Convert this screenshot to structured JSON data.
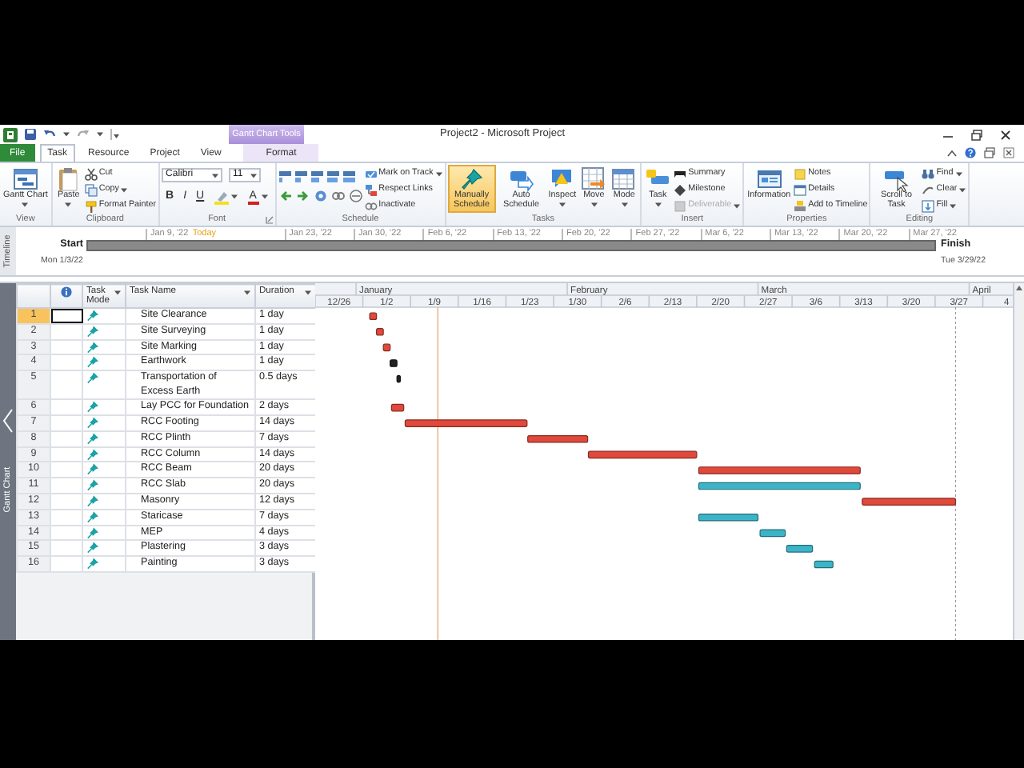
{
  "title_bar": {
    "context_group": "Gantt Chart Tools",
    "title": "Project2 - Microsoft Project"
  },
  "tabs": [
    {
      "label": "File",
      "kind": "file",
      "selected": false
    },
    {
      "label": "Task",
      "kind": "normal",
      "selected": true
    },
    {
      "label": "Resource",
      "kind": "normal",
      "selected": false
    },
    {
      "label": "Project",
      "kind": "normal",
      "selected": false
    },
    {
      "label": "View",
      "kind": "normal",
      "selected": false
    },
    {
      "label": "Format",
      "kind": "context",
      "selected": false
    }
  ],
  "ribbon": {
    "groups": [
      {
        "label": "View",
        "launcher": false,
        "items": [
          {
            "kind": "large",
            "label": "Gantt Chart",
            "caret": true,
            "selected": false
          }
        ]
      },
      {
        "label": "Clipboard",
        "launcher": false,
        "items": [
          {
            "kind": "large",
            "label": "Paste",
            "caret": true,
            "selected": false
          },
          {
            "kind": "stack",
            "entries": [
              {
                "label": "Cut",
                "caret": false,
                "disabled": false
              },
              {
                "label": "Copy",
                "caret": true,
                "disabled": false
              },
              {
                "label": "Format Painter",
                "caret": false,
                "disabled": false
              }
            ]
          }
        ]
      },
      {
        "label": "Font",
        "launcher": true,
        "items": [
          {
            "kind": "font",
            "font": "Calibri",
            "size": "11",
            "styles": [
              "B",
              "I",
              "U"
            ],
            "color_glyph": "A"
          }
        ]
      },
      {
        "label": "Schedule",
        "launcher": false,
        "items": [
          {
            "kind": "icon-grid"
          },
          {
            "kind": "stack",
            "entries": [
              {
                "label": "Mark on Track",
                "caret": true,
                "disabled": false
              },
              {
                "label": "Respect Links",
                "caret": false,
                "disabled": false
              },
              {
                "label": "Inactivate",
                "caret": false,
                "disabled": false
              }
            ]
          }
        ]
      },
      {
        "label": "Tasks",
        "launcher": false,
        "items": [
          {
            "kind": "large",
            "label": "Manually Schedule",
            "caret": false,
            "selected": true
          },
          {
            "kind": "large",
            "label": "Auto Schedule",
            "caret": false,
            "selected": false
          },
          {
            "kind": "large",
            "label": "Inspect",
            "caret": true,
            "selected": false
          },
          {
            "kind": "large",
            "label": "Move",
            "caret": true,
            "selected": false
          },
          {
            "kind": "large",
            "label": "Mode",
            "caret": true,
            "selected": false
          }
        ]
      },
      {
        "label": "Insert",
        "launcher": false,
        "items": [
          {
            "kind": "large",
            "label": "Task",
            "caret": true,
            "selected": false
          },
          {
            "kind": "stack",
            "entries": [
              {
                "label": "Summary",
                "caret": false,
                "disabled": false
              },
              {
                "label": "Milestone",
                "caret": false,
                "disabled": false
              },
              {
                "label": "Deliverable",
                "caret": true,
                "disabled": true
              }
            ]
          }
        ]
      },
      {
        "label": "Properties",
        "launcher": false,
        "items": [
          {
            "kind": "large",
            "label": "Information",
            "caret": false,
            "selected": false
          },
          {
            "kind": "stack",
            "entries": [
              {
                "label": "Notes",
                "caret": false,
                "disabled": false
              },
              {
                "label": "Details",
                "caret": false,
                "disabled": false
              },
              {
                "label": "Add to Timeline",
                "caret": false,
                "disabled": false
              }
            ]
          }
        ]
      },
      {
        "label": "Editing",
        "launcher": false,
        "items": [
          {
            "kind": "large",
            "label": "Scroll to Task",
            "caret": false,
            "selected": false
          },
          {
            "kind": "stack",
            "entries": [
              {
                "label": "Find",
                "caret": true,
                "disabled": false
              },
              {
                "label": "Clear",
                "caret": true,
                "disabled": false
              },
              {
                "label": "Fill",
                "caret": true,
                "disabled": false
              }
            ]
          }
        ]
      }
    ]
  },
  "timeline": {
    "label": "Timeline",
    "start_label": "Start",
    "start_date": "Mon 1/3/22",
    "finish_label": "Finish",
    "finish_date": "Tue 3/29/22",
    "ticks": [
      {
        "label": "Jan 9, '22",
        "kind": "date"
      },
      {
        "label": "Today",
        "kind": "today"
      },
      {
        "label": "Jan 23, '22",
        "kind": "date"
      },
      {
        "label": "Jan 30, '22",
        "kind": "date"
      },
      {
        "label": "Feb 6, '22",
        "kind": "date"
      },
      {
        "label": "Feb 13, '22",
        "kind": "date"
      },
      {
        "label": "Feb 20, '22",
        "kind": "date"
      },
      {
        "label": "Feb 27, '22",
        "kind": "date"
      },
      {
        "label": "Mar 6, '22",
        "kind": "date"
      },
      {
        "label": "Mar 13, '22",
        "kind": "date"
      },
      {
        "label": "Mar 20, '22",
        "kind": "date"
      },
      {
        "label": "Mar 27, '22",
        "kind": "date"
      }
    ]
  },
  "view_bar": {
    "label": "Gantt Chart"
  },
  "table": {
    "columns": [
      {
        "kind": "indicators"
      },
      {
        "kind": "mode",
        "label": "Task Mode"
      },
      {
        "kind": "name",
        "label": "Task Name"
      },
      {
        "kind": "duration",
        "label": "Duration"
      }
    ],
    "rows": [
      {
        "id": "1",
        "name": "Site Clearance",
        "duration": "1 day",
        "selected": true,
        "color": "#e0493b"
      },
      {
        "id": "2",
        "name": "Site Surveying",
        "duration": "1 day",
        "selected": false,
        "color": "#e0493b"
      },
      {
        "id": "3",
        "name": "Site Marking",
        "duration": "1 day",
        "selected": false,
        "color": "#e0493b"
      },
      {
        "id": "4",
        "name": "Earthwork",
        "duration": "1 day",
        "selected": false,
        "color": "#222222"
      },
      {
        "id": "5",
        "name": "Transportation of Excess Earth",
        "duration": "0.5 days",
        "selected": false,
        "color": "#222222"
      },
      {
        "id": "6",
        "name": "Lay PCC for Foundation",
        "duration": "2 days",
        "selected": false,
        "color": "#e0493b"
      },
      {
        "id": "7",
        "name": "RCC Footing",
        "duration": "14 days",
        "selected": false,
        "color": "#e0493b"
      },
      {
        "id": "8",
        "name": "RCC Plinth",
        "duration": "7 days",
        "selected": false,
        "color": "#e0493b"
      },
      {
        "id": "9",
        "name": "RCC Column",
        "duration": "14 days",
        "selected": false,
        "color": "#e0493b"
      },
      {
        "id": "10",
        "name": "RCC Beam",
        "duration": "20 days",
        "selected": false,
        "color": "#e0493b"
      },
      {
        "id": "11",
        "name": "RCC Slab",
        "duration": "20 days",
        "selected": false,
        "color": "#3cb4c8"
      },
      {
        "id": "12",
        "name": "Masonry",
        "duration": "12 days",
        "selected": false,
        "color": "#e0493b"
      },
      {
        "id": "13",
        "name": "Staricase",
        "duration": "7 days",
        "selected": false,
        "color": "#3cb4c8"
      },
      {
        "id": "14",
        "name": "MEP",
        "duration": "4 days",
        "selected": false,
        "color": "#3cb4c8"
      },
      {
        "id": "15",
        "name": "Plastering",
        "duration": "3 days",
        "selected": false,
        "color": "#3cb4c8"
      },
      {
        "id": "16",
        "name": "Painting",
        "duration": "3 days",
        "selected": false,
        "color": "#3cb4c8"
      }
    ]
  },
  "gantt": {
    "months": [
      "January",
      "February",
      "March",
      "April"
    ],
    "weeks": [
      "12/26",
      "1/2",
      "1/9",
      "1/16",
      "1/23",
      "1/30",
      "2/6",
      "2/13",
      "2/20",
      "2/27",
      "3/6",
      "3/13",
      "3/20",
      "3/27",
      "4"
    ]
  }
}
